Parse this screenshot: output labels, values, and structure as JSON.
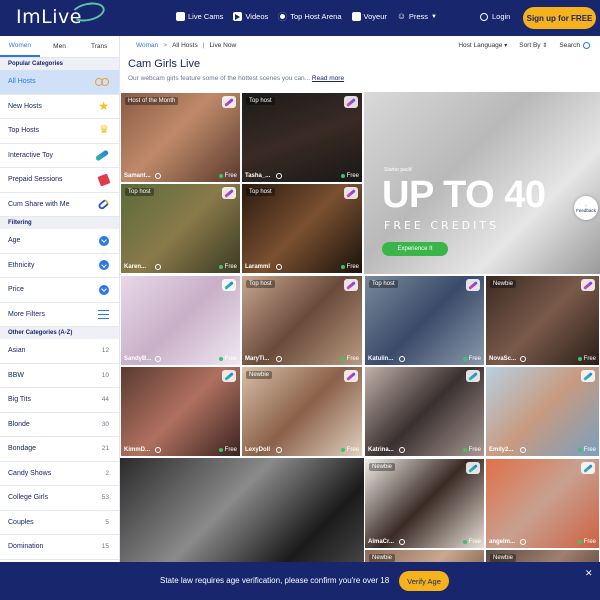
{
  "header": {
    "logo": "ImLive",
    "nav": [
      {
        "label": "Live Cams",
        "icon": "live-cams-icon"
      },
      {
        "label": "Videos",
        "icon": "play-icon"
      },
      {
        "label": "Top Host Arena",
        "icon": "arena-icon"
      },
      {
        "label": "Voyeur",
        "icon": "voyeur-icon"
      },
      {
        "label": "Press",
        "icon": "press-icon"
      }
    ],
    "login": "Login",
    "signup": "Sign up for FREE"
  },
  "sidebar": {
    "tabs": [
      "Women",
      "Men",
      "Trans"
    ],
    "popular_title": "Popular Categories",
    "popular": [
      {
        "label": "All Hosts",
        "icon": "infinity-icon"
      },
      {
        "label": "New Hosts",
        "icon": "star-icon"
      },
      {
        "label": "Top Hosts",
        "icon": "crown-icon"
      },
      {
        "label": "Interactive Toy",
        "icon": "toy-icon"
      },
      {
        "label": "Prepaid Sessions",
        "icon": "ticket-icon"
      },
      {
        "label": "Cum Share with Me",
        "icon": "link-icon"
      }
    ],
    "filtering_title": "Filtering",
    "filters": [
      {
        "label": "Age"
      },
      {
        "label": "Ethnicity"
      },
      {
        "label": "Price"
      },
      {
        "label": "More Filters"
      }
    ],
    "other_title": "Other Categories (A-Z)",
    "other": [
      {
        "label": "Asian",
        "count": "12"
      },
      {
        "label": "BBW",
        "count": "10"
      },
      {
        "label": "Big Tits",
        "count": "44"
      },
      {
        "label": "Blonde",
        "count": "30"
      },
      {
        "label": "Bondage",
        "count": "21"
      },
      {
        "label": "Candy Shows",
        "count": "2"
      },
      {
        "label": "College Girls",
        "count": "53"
      },
      {
        "label": "Couples",
        "count": "5"
      },
      {
        "label": "Domination",
        "count": "15"
      }
    ]
  },
  "main": {
    "breadcrumb": [
      "Woman",
      "All Hosts",
      "Live Now"
    ],
    "host_language": "Host Language",
    "sort_by": "Sort By",
    "search": "Search",
    "title": "Cam Girls Live",
    "description": "Our webcam girls feature some of the hottest scenes you can...",
    "read_more": "Read more"
  },
  "promo": {
    "starter": "Starter pack!",
    "headline": "UP TO 40",
    "subline": "FREE CREDITS",
    "button": "Experience It",
    "feedback": "Feedback"
  },
  "hosts": [
    {
      "name": "Samant...",
      "badge": "Host of the Month",
      "status": "Free",
      "toy": "pink",
      "bg": "linear-gradient(135deg,#8a5a44,#c08a6a 45%,#5a3a2e)"
    },
    {
      "name": "Tasha_...",
      "badge": "Top host",
      "status": "Free",
      "toy": "pink",
      "bg": "linear-gradient(160deg,#1b1b1b,#3a2a24 50%,#181818)"
    },
    {
      "name": "Karen...",
      "badge": "Top host",
      "status": "Free",
      "toy": "pink",
      "bg": "linear-gradient(135deg,#5a6a3a,#8a7a4a 50%,#3a3a22)"
    },
    {
      "name": "Laramml",
      "badge": "Top host",
      "status": "Free",
      "toy": "pink",
      "bg": "linear-gradient(135deg,#2a1a10,#7a5030 50%,#1a120c)"
    },
    {
      "name": "SandyB...",
      "badge": "",
      "status": "Free",
      "toy": "teal",
      "bg": "linear-gradient(135deg,#e8d8e8,#c8b0c8 50%,#f0e8f0)"
    },
    {
      "name": "MaryTi...",
      "badge": "Top host",
      "status": "Free",
      "toy": "pink",
      "bg": "linear-gradient(135deg,#c8a890,#6a4a3a 50%,#b89a80)"
    },
    {
      "name": "Katulin...",
      "badge": "Top host",
      "status": "Free",
      "toy": "pink",
      "bg": "linear-gradient(135deg,#7a8a9a,#3a4a6a 50%,#8a9aaa)"
    },
    {
      "name": "NovaSc...",
      "badge": "Newbie",
      "status": "Free",
      "toy": "pink",
      "bg": "linear-gradient(135deg,#3a2a22,#7a5a4a 50%,#2a1e18)"
    },
    {
      "name": "KimmD...",
      "badge": "",
      "status": "Free",
      "toy": "teal",
      "bg": "linear-gradient(135deg,#5a3a30,#b07060 50%,#3a2420)"
    },
    {
      "name": "LexyDoll",
      "badge": "Newbie",
      "status": "Free",
      "toy": "pink",
      "bg": "linear-gradient(135deg,#d8c0a8,#8a6048 50%,#e0d0c0)"
    },
    {
      "name": "Katrina...",
      "badge": "",
      "status": "Free",
      "toy": "teal",
      "bg": "linear-gradient(135deg,#c0b0a8,#3a3030 50%,#a89890)"
    },
    {
      "name": "Emily2...",
      "badge": "",
      "status": "Free",
      "toy": "teal",
      "bg": "linear-gradient(135deg,#b8d0e0,#c89a80 50%,#7aa0c0)"
    },
    {
      "name": "AlmaCr...",
      "badge": "Newbie",
      "status": "Free",
      "toy": "teal",
      "bg": "linear-gradient(135deg,#f0ece8,#3a2a24 50%,#e8e0d8)"
    },
    {
      "name": "angelm...",
      "badge": "",
      "status": "Free",
      "toy": "teal",
      "bg": "linear-gradient(135deg,#e07048,#c8a090 50%,#d06040)"
    },
    {
      "name": "",
      "badge": "Newbie",
      "status": "",
      "toy": "",
      "bg": "linear-gradient(135deg,#8a6a5a,#c8a890 50%,#6a4a3a)"
    },
    {
      "name": "",
      "badge": "Newbie",
      "status": "",
      "toy": "",
      "bg": "linear-gradient(135deg,#5a4a40,#a08070 50%,#4a3a30)"
    }
  ],
  "big_tile": {
    "bg": "linear-gradient(135deg,#2a2a2a,#8a8a8a 40%,#1a1a1a 70%,#5a5a5a)"
  },
  "age_banner": {
    "text": "State law requires age verification, please confirm you're over 18",
    "button": "Verify Age",
    "close": "✕"
  }
}
